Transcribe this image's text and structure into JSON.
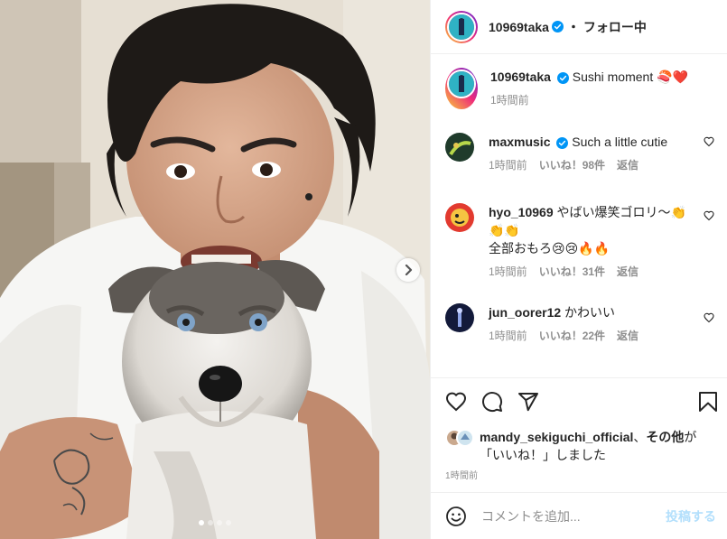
{
  "post": {
    "author": "10969taka",
    "follow_status": "・ フォロー中",
    "caption_text": "Sushi moment 🍣❤️",
    "caption_time": "1時間前",
    "carousel": {
      "current_slide": 1,
      "total_slides": 4
    }
  },
  "comments": [
    {
      "user": "maxmusic",
      "verified": true,
      "text": "Such a little cutie",
      "time": "1時間前",
      "likes": "いいね！98件",
      "reply": "返信"
    },
    {
      "user": "hyo_10969",
      "verified": false,
      "text": "やばい爆笑ゴロリ〜👏",
      "text2": "👏👏",
      "text3": "全部おもろ😢😢🔥🔥",
      "time": "1時間前",
      "likes": "いいね！31件",
      "reply": "返信"
    },
    {
      "user": "jun_oorer12",
      "verified": false,
      "text": "かわいい",
      "time": "1時間前",
      "likes": "いいね！22件",
      "reply": "返信"
    }
  ],
  "actions": {
    "liked_by_user": "mandy_sekiguchi_official",
    "liked_by_connector": "、",
    "liked_by_others": "その他",
    "liked_by_suffix": "が",
    "liked_by_line2": "「いいね！」しました",
    "post_time": "1時間前"
  },
  "comment_input": {
    "placeholder": "コメントを追加...",
    "post_label": "投稿する"
  },
  "icons": {
    "like": "heart-icon",
    "comment": "comment-bubble-icon",
    "share": "paper-plane-icon",
    "save": "bookmark-icon",
    "emoji": "smiley-icon",
    "next": "chevron-right-icon",
    "verified": "verified-badge-icon"
  },
  "colors": {
    "verified_blue": "#0095f6",
    "post_button_disabled": "#b2dffc",
    "meta_gray": "#8e8e8e"
  }
}
